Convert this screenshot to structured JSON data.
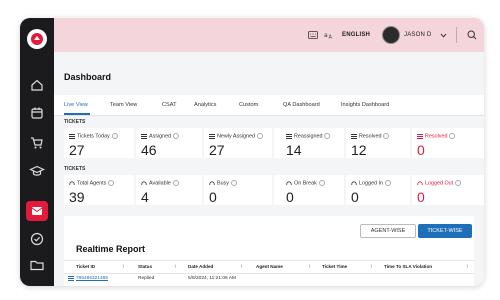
{
  "topbar": {
    "language": "ENGLISH",
    "user_name": "JASON D"
  },
  "page": {
    "title": "Dashboard"
  },
  "tabs": [
    {
      "label": "Live View",
      "active": true
    },
    {
      "label": "Team View"
    },
    {
      "label": "CSAT"
    },
    {
      "label": "Analytics"
    },
    {
      "label": "Custom"
    },
    {
      "label": "QA Dashboard"
    },
    {
      "label": "Insights Dashboard"
    }
  ],
  "tickets": {
    "section_label": "TICKETS",
    "cards": [
      {
        "label": "Tickets Today",
        "value": "27"
      },
      {
        "label": "Assigned",
        "value": "46"
      },
      {
        "label": "Newly Assigned",
        "value": "27"
      },
      {
        "label": "Reassigned",
        "value": "14"
      },
      {
        "label": "Resolved",
        "value": "12"
      },
      {
        "label": "Resolved",
        "value": "0"
      }
    ]
  },
  "agents": {
    "section_label": "TICKETS",
    "cards": [
      {
        "label": "Total Agents",
        "value": "39"
      },
      {
        "label": "Available",
        "value": "4"
      },
      {
        "label": "Busy",
        "value": "0"
      },
      {
        "label": "On Break",
        "value": "0"
      },
      {
        "label": "Logged In",
        "value": "0"
      },
      {
        "label": "Logged Out",
        "value": "0"
      }
    ]
  },
  "report": {
    "agent_wise": "AGENT-WISE",
    "ticket_wise": "TICKET-WISE",
    "title": "Realtime Report",
    "columns": [
      "Ticket ID",
      "Status",
      "Date Added",
      "Agent Name",
      "Ticket Time",
      "Time To SLA Violation"
    ],
    "rows": [
      {
        "ticket_id": "785486321485",
        "status": "Replied",
        "date_added": "5/8/2024, 11:21:06 AM"
      }
    ]
  },
  "colors": {
    "accent": "#1f6fb8",
    "brand_red": "#e21b3c",
    "sidebar": "#1b1b1d",
    "topbar": "#f3d5db"
  }
}
